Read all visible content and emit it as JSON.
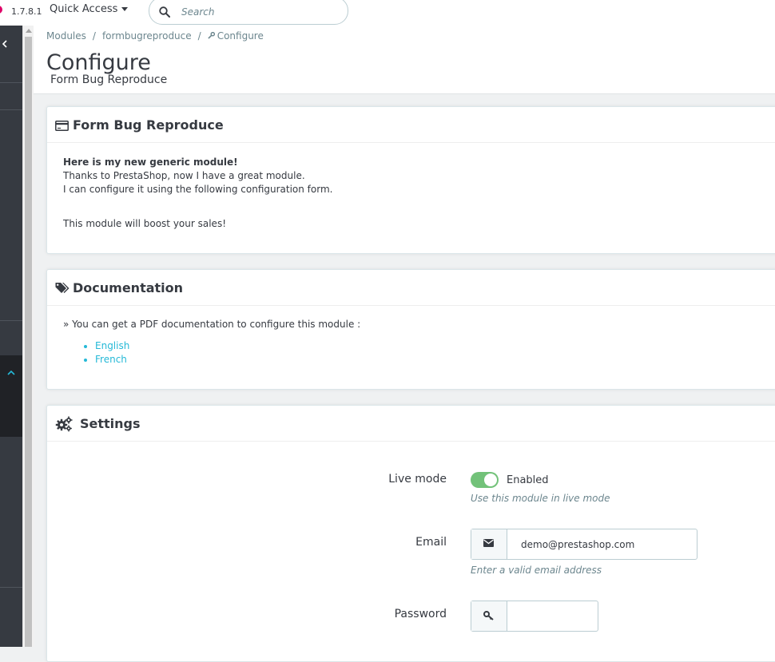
{
  "header": {
    "version": "1.7.8.1",
    "quick_access_label": "Quick Access",
    "search_placeholder": "Search"
  },
  "breadcrumb": {
    "items": [
      "Modules",
      "formbugreproduce",
      "Configure"
    ]
  },
  "page": {
    "title": "Configure",
    "subtitle": "Form Bug Reproduce"
  },
  "intro_panel": {
    "heading": "Form Bug Reproduce",
    "line_bold": "Here is my new generic module!",
    "line_1": "Thanks to PrestaShop, now I have a great module.",
    "line_2": "I can configure it using the following configuration form.",
    "line_3": "This module will boost your sales!"
  },
  "doc_panel": {
    "heading": "Documentation",
    "text": "» You can get a PDF documentation to configure this module :",
    "links": [
      "English",
      "French"
    ]
  },
  "settings_panel": {
    "heading": "Settings",
    "live_mode": {
      "label": "Live mode",
      "state_label": "Enabled",
      "enabled": true,
      "help": "Use this module in live mode"
    },
    "email": {
      "label": "Email",
      "value": "demo@prestashop.com",
      "help": "Enter a valid email address"
    },
    "password": {
      "label": "Password",
      "value": ""
    }
  },
  "colors": {
    "brand": "#df0067",
    "sidebar": "#363a41",
    "link": "#25b9d7",
    "switch_on": "#72c279"
  }
}
